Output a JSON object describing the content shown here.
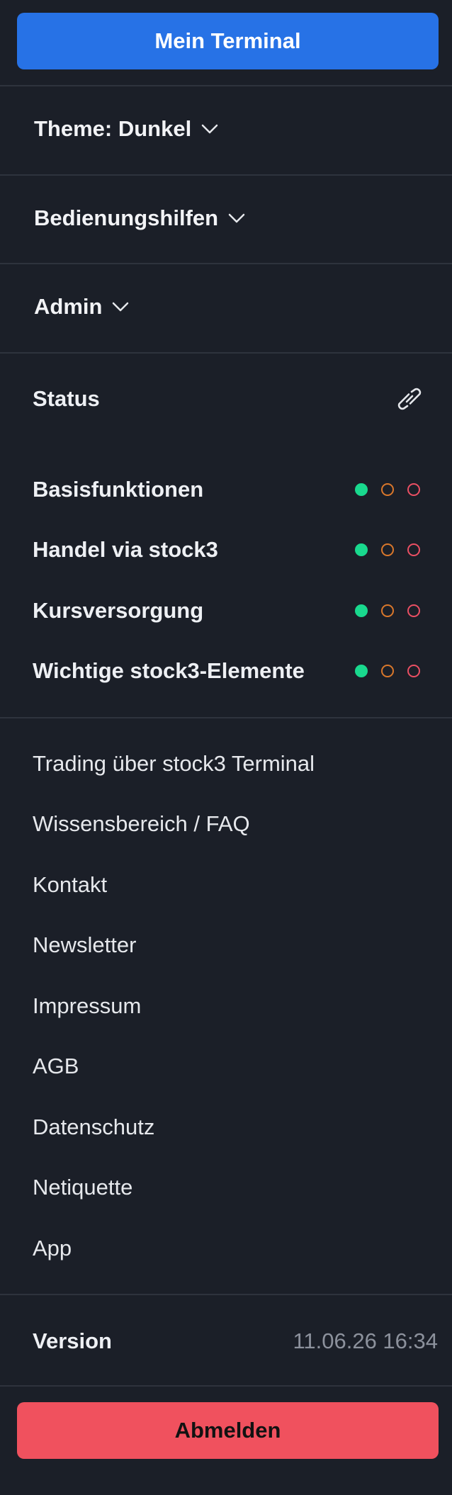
{
  "primary_button": {
    "label": "Mein Terminal"
  },
  "dropdowns": [
    {
      "label": "Theme: Dunkel",
      "icon": "chevron-down-icon"
    },
    {
      "label": "Bedienungshilfen",
      "icon": "chevron-down-icon"
    },
    {
      "label": "Admin",
      "icon": "chevron-down-icon"
    }
  ],
  "status": {
    "title": "Status",
    "link_icon": "paperclip-icon",
    "items": [
      {
        "label": "Basisfunktionen",
        "state": "green"
      },
      {
        "label": "Handel via stock3",
        "state": "green"
      },
      {
        "label": "Kursversorgung",
        "state": "green"
      },
      {
        "label": "Wichtige stock3-Elemente",
        "state": "green"
      }
    ],
    "colors": {
      "green": "#19d98e",
      "orange": "#d9772b",
      "red": "#ea4f63"
    }
  },
  "links": [
    "Trading über stock3 Terminal",
    "Wissensbereich / FAQ",
    "Kontakt",
    "Newsletter",
    "Impressum",
    "AGB",
    "Datenschutz",
    "Netiquette",
    "App"
  ],
  "version": {
    "label": "Version",
    "value": "11.06.26 16:34"
  },
  "logout_button": {
    "label": "Abmelden"
  },
  "theme": {
    "background": "#1b1f28",
    "primary": "#2772e6",
    "danger": "#f0515e"
  }
}
